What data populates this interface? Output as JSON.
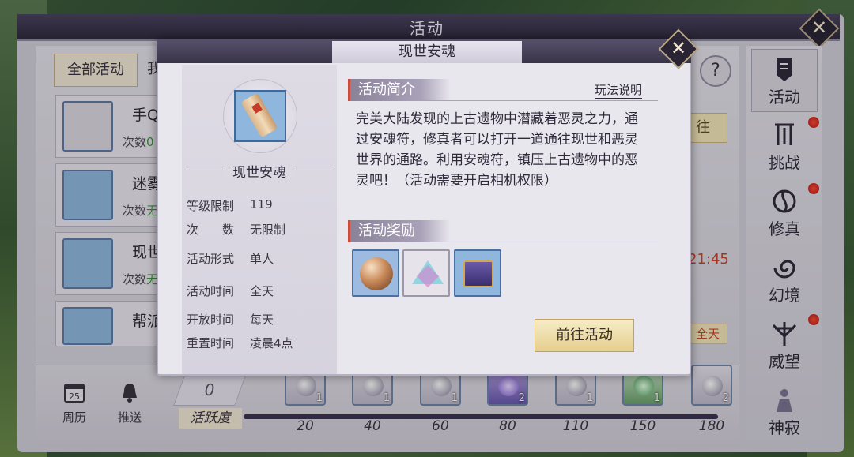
{
  "window": {
    "title": "活动"
  },
  "tabs": {
    "all": "全部活动",
    "other": "我"
  },
  "activities": [
    {
      "name": "手Q",
      "count_label": "次数",
      "count_value": "0"
    },
    {
      "name": "迷雾",
      "count_label": "次数",
      "count_value": "无"
    },
    {
      "name": "现世",
      "count_label": "次数",
      "count_value": "无"
    },
    {
      "name": "帮派",
      "count_label": "",
      "count_value": ""
    }
  ],
  "right_peek": {
    "btn": "往",
    "time": "21:45",
    "all_day": "全天"
  },
  "bottom": {
    "calendar": "周历",
    "push": "推送",
    "calendar_date": "25",
    "active_value": "0",
    "active_label": "活跃度",
    "milestones": [
      {
        "value": "20",
        "count": "1"
      },
      {
        "value": "40",
        "count": "1"
      },
      {
        "value": "60",
        "count": "1"
      },
      {
        "value": "80",
        "count": "2"
      },
      {
        "value": "110",
        "count": "1"
      },
      {
        "value": "150",
        "count": "1"
      },
      {
        "value": "180",
        "count": "2"
      }
    ]
  },
  "sidebar": [
    {
      "label": "活动",
      "icon": "activity-icon"
    },
    {
      "label": "挑战",
      "icon": "challenge-icon"
    },
    {
      "label": "修真",
      "icon": "cultivate-icon"
    },
    {
      "label": "幻境",
      "icon": "illusion-icon"
    },
    {
      "label": "威望",
      "icon": "prestige-icon"
    },
    {
      "label": "神寂",
      "icon": "divine-icon"
    }
  ],
  "help": "?",
  "modal": {
    "title": "现世安魂",
    "name": "现世安魂",
    "info": [
      {
        "label": "等级限制",
        "value": "119"
      },
      {
        "label": "次　　数",
        "value": "无限制"
      },
      {
        "label": "活动形式",
        "value": "单人"
      },
      {
        "label": "活动时间",
        "value": "全天"
      },
      {
        "label": "开放时间",
        "value": "每天"
      },
      {
        "label": "重置时间",
        "value": "凌晨4点"
      }
    ],
    "intro_title": "活动简介",
    "rule_link": "玩法说明",
    "description": "完美大陆发现的上古遗物中潜藏着恶灵之力，通过安魂符，修真者可以打开一道通往现世和恶灵世界的通路。利用安魂符，镇压上古遗物中的恶灵吧！（活动需要开启相机权限）",
    "reward_title": "活动奖励",
    "go_button": "前往活动"
  }
}
